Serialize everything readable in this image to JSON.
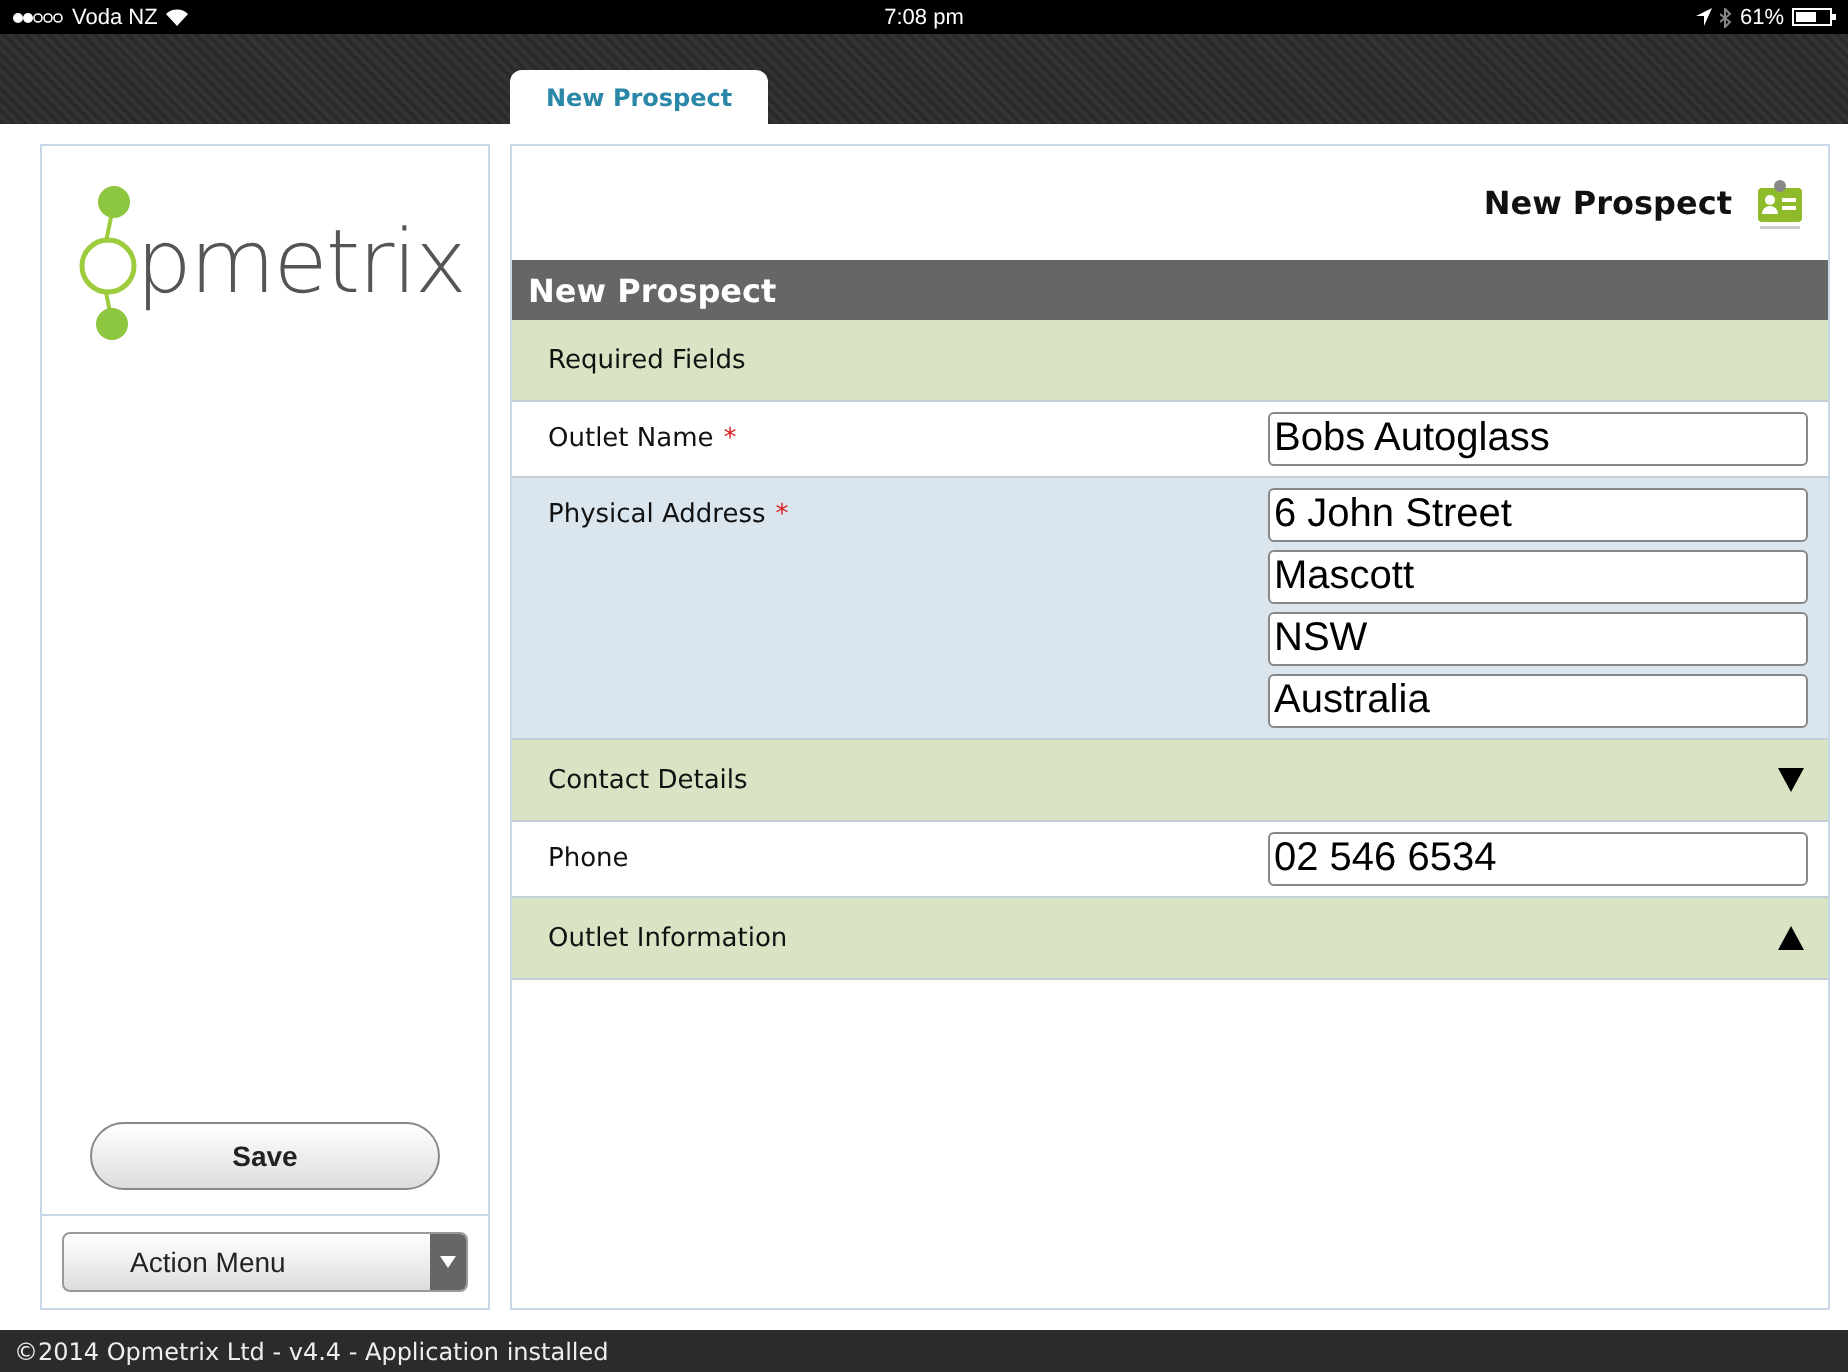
{
  "status_bar": {
    "carrier": "Voda NZ",
    "time": "7:08 pm",
    "battery": "61%"
  },
  "tabs": [
    {
      "label": "New Prospect",
      "selected": true
    }
  ],
  "sidebar": {
    "logo_text": "pmetrix",
    "save_button": "Save",
    "action_menu": "Action Menu"
  },
  "page_header": {
    "title": "New Prospect"
  },
  "form": {
    "title": "New Prospect",
    "rows": [
      {
        "kind": "section",
        "label": "Required Fields"
      },
      {
        "kind": "field",
        "label": "Outlet Name",
        "required_mark": "*",
        "values": [
          "Bobs Autoglass"
        ]
      },
      {
        "kind": "field",
        "label": "Physical Address",
        "required_mark": "*",
        "values": [
          "6 John Street",
          "Mascott",
          "NSW",
          "Australia"
        ]
      },
      {
        "kind": "section",
        "label": "Contact Details",
        "expanded": true
      },
      {
        "kind": "field",
        "label": "Phone",
        "values": [
          "02 546 6534"
        ]
      },
      {
        "kind": "section",
        "label": "Outlet Information",
        "expanded": false
      }
    ]
  },
  "footer": {
    "text": "©2014 Opmetrix Ltd - v4.4 - Application installed"
  }
}
